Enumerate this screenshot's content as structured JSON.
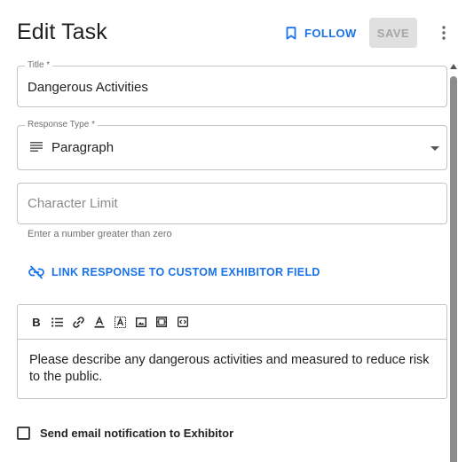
{
  "header": {
    "title": "Edit Task",
    "follow_label": "FOLLOW",
    "save_label": "SAVE"
  },
  "fields": {
    "title": {
      "label": "Title *",
      "value": "Dangerous Activities"
    },
    "response_type": {
      "label": "Response Type *",
      "value": "Paragraph",
      "icon": "paragraph-lines-icon"
    },
    "character_limit": {
      "placeholder": "Character Limit",
      "value": "",
      "helper": "Enter a number greater than zero"
    }
  },
  "link_action": {
    "label": "LINK RESPONSE TO CUSTOM EXHIBITOR FIELD",
    "icon": "link-off-icon"
  },
  "editor": {
    "toolbar": [
      "bold-icon",
      "bulleted-list-icon",
      "link-icon",
      "text-color-icon",
      "highlight-icon",
      "image-icon",
      "video-icon",
      "code-icon"
    ],
    "content": "Please describe any dangerous activities and measured to reduce risk to the public."
  },
  "notification": {
    "label": "Send email notification to Exhibitor",
    "checked": false
  },
  "colors": {
    "accent": "#1a73e8",
    "border": "#c4c4c4",
    "disabled_bg": "#e0e0e0"
  }
}
